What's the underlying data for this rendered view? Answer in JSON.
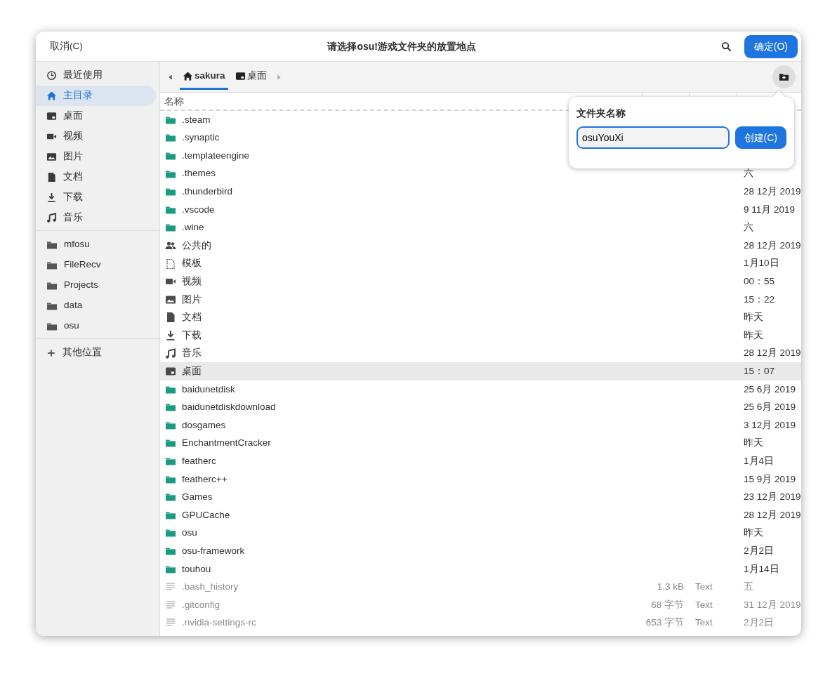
{
  "dialog": {
    "cancel_button": "取消(C)",
    "title": "请选择osu!游戏文件夹的放置地点",
    "confirm_button": "确定(O)"
  },
  "sidebar": {
    "places": [
      {
        "kind": "recent",
        "label": "最近使用",
        "selected": false
      },
      {
        "kind": "home",
        "label": "主目录",
        "selected": true
      },
      {
        "kind": "desktop",
        "label": "桌面",
        "selected": false
      },
      {
        "kind": "video",
        "label": "视频",
        "selected": false
      },
      {
        "kind": "picture",
        "label": "图片",
        "selected": false
      },
      {
        "kind": "document",
        "label": "文档",
        "selected": false
      },
      {
        "kind": "download",
        "label": "下载",
        "selected": false
      },
      {
        "kind": "music",
        "label": "音乐",
        "selected": false
      }
    ],
    "bookmarks": [
      {
        "label": "mfosu"
      },
      {
        "label": "FileRecv"
      },
      {
        "label": "Projects"
      },
      {
        "label": "data"
      },
      {
        "label": "osu"
      }
    ],
    "other_locations": "其他位置"
  },
  "path_bar": {
    "segments": [
      {
        "kind": "home",
        "label": "sakura",
        "selected": true
      },
      {
        "kind": "desktop",
        "label": "桌面",
        "selected": false
      }
    ]
  },
  "file_list": {
    "columns": [
      "名称"
    ],
    "rows": [
      {
        "kind": "folder",
        "name": ".steam",
        "selected": false
      },
      {
        "kind": "folder",
        "name": ".synaptic",
        "selected": false
      },
      {
        "kind": "folder",
        "name": ".templateengine",
        "selected": false
      },
      {
        "kind": "folder",
        "name": ".themes",
        "date": "六",
        "selected": false
      },
      {
        "kind": "folder",
        "name": ".thunderbird",
        "date": "28 12月 2019",
        "selected": false
      },
      {
        "kind": "folder",
        "name": ".vscode",
        "date": "9 11月 2019",
        "selected": false
      },
      {
        "kind": "folder",
        "name": ".wine",
        "date": "六",
        "selected": false
      },
      {
        "kind": "people",
        "name": "公共的",
        "date": "28 12月 2019",
        "selected": false
      },
      {
        "kind": "template",
        "name": "模板",
        "date": "1月10日",
        "selected": false
      },
      {
        "kind": "video",
        "name": "视频",
        "date": "00：55",
        "selected": false
      },
      {
        "kind": "picture",
        "name": "图片",
        "date": "15：22",
        "selected": false
      },
      {
        "kind": "document",
        "name": "文档",
        "date": "昨天",
        "selected": false
      },
      {
        "kind": "download",
        "name": "下载",
        "date": "昨天",
        "selected": false
      },
      {
        "kind": "music",
        "name": "音乐",
        "date": "28 12月 2019",
        "selected": false
      },
      {
        "kind": "desktop",
        "name": "桌面",
        "date": "15：07",
        "selected": true
      },
      {
        "kind": "folder",
        "name": "baidunetdisk",
        "date": "25 6月 2019",
        "selected": false
      },
      {
        "kind": "folder",
        "name": "baidunetdiskdownload",
        "date": "25 6月 2019",
        "selected": false
      },
      {
        "kind": "folder",
        "name": "dosgames",
        "date": "3 12月 2019",
        "selected": false
      },
      {
        "kind": "folder",
        "name": "EnchantmentCracker",
        "date": "昨天",
        "selected": false
      },
      {
        "kind": "folder",
        "name": "featherc",
        "date": "1月4日",
        "selected": false
      },
      {
        "kind": "folder",
        "name": "featherc++",
        "date": "15 9月 2019",
        "selected": false
      },
      {
        "kind": "folder",
        "name": "Games",
        "date": "23 12月 2019",
        "selected": false
      },
      {
        "kind": "folder",
        "name": "GPUCache",
        "date": "28 12月 2019",
        "selected": false
      },
      {
        "kind": "folder",
        "name": "osu",
        "date": "昨天",
        "selected": false
      },
      {
        "kind": "folder",
        "name": "osu-framework",
        "date": "2月2日",
        "selected": false
      },
      {
        "kind": "folder",
        "name": "touhou",
        "date": "1月14日",
        "selected": false
      },
      {
        "kind": "text",
        "name": ".bash_history",
        "size": "1.3 kB",
        "type": "Text",
        "date": "五",
        "selected": false
      },
      {
        "kind": "text",
        "name": ".gitconfig",
        "size": "68 字节",
        "type": "Text",
        "date": "31 12月 2019",
        "selected": false
      },
      {
        "kind": "text",
        "name": ".nvidia-settings-rc",
        "size": "653 字节",
        "type": "Text",
        "date": "2月2日",
        "selected": false
      }
    ]
  },
  "new_folder_popover": {
    "title": "文件夹名称",
    "value": "osuYouXi",
    "create_button": "创建(C)"
  }
}
